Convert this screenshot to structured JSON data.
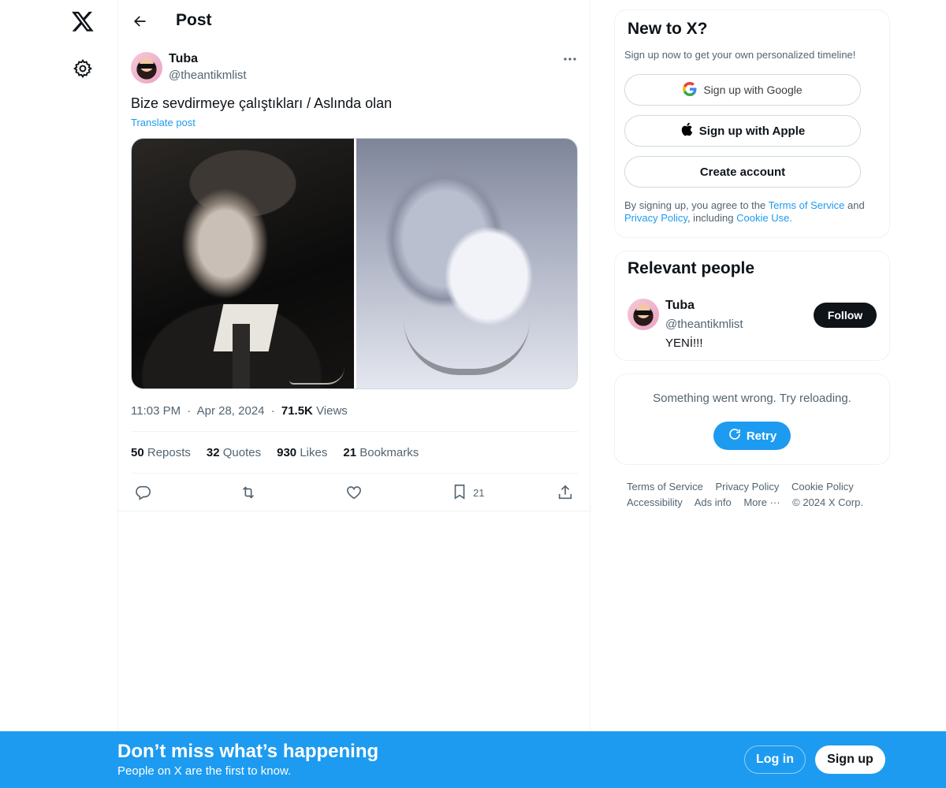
{
  "nav": {
    "logo_icon": "x-logo-icon",
    "settings_icon": "gear-icon"
  },
  "header": {
    "title": "Post",
    "back_icon": "arrow-left-icon"
  },
  "post": {
    "author_name": "Tuba",
    "author_handle": "@theantikmlist",
    "text": "Bize sevdirmeye çalıştıkları / Aslında olan",
    "translate_label": "Translate post",
    "time": "11:03 PM",
    "date": "Apr 28, 2024",
    "views_count": "71.5K",
    "views_label": "Views",
    "stats": {
      "reposts_count": "50",
      "reposts_label": "Reposts",
      "quotes_count": "32",
      "quotes_label": "Quotes",
      "likes_count": "930",
      "likes_label": "Likes",
      "bookmarks_count": "21",
      "bookmarks_label": "Bookmarks"
    },
    "actions": {
      "bookmark_count": "21"
    },
    "separator": "·"
  },
  "signup_card": {
    "title": "New to X?",
    "subtitle": "Sign up now to get your own personalized timeline!",
    "google_label": "Sign up with Google",
    "apple_label": "Sign up with Apple",
    "create_label": "Create account",
    "terms_prefix": "By signing up, you agree to the ",
    "terms_link": "Terms of Service",
    "terms_and": " and ",
    "privacy_link": "Privacy Policy",
    "terms_including": ", including ",
    "cookie_link": "Cookie Use."
  },
  "people_card": {
    "title": "Relevant people",
    "name": "Tuba",
    "handle": "@theantikmlist",
    "bio": "YENİ!!!",
    "follow_label": "Follow"
  },
  "error_card": {
    "message": "Something went wrong. Try reloading.",
    "retry_label": "Retry"
  },
  "footer": {
    "links": [
      "Terms of Service",
      "Privacy Policy",
      "Cookie Policy",
      "Accessibility",
      "Ads info",
      "More ···",
      "© 2024 X Corp."
    ]
  },
  "banner": {
    "title": "Don’t miss what’s happening",
    "subtitle": "People on X are the first to know.",
    "login_label": "Log in",
    "signup_label": "Sign up"
  },
  "colors": {
    "accent": "#1d9bf0",
    "text": "#0f1419",
    "muted": "#536471"
  }
}
